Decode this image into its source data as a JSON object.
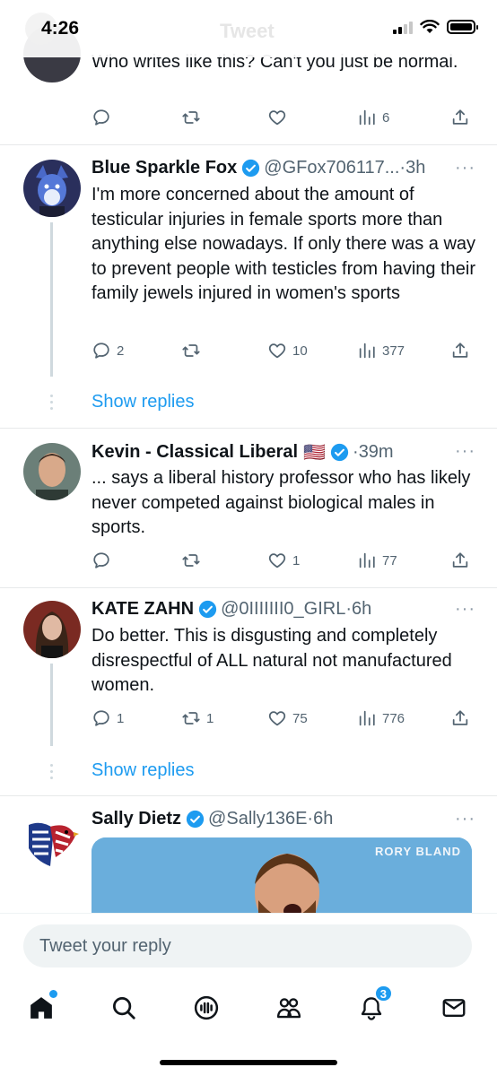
{
  "status_bar": {
    "time": "4:26",
    "header_title": "Tweet"
  },
  "partial_tweet": {
    "text": "Who writes like this? Can't you just be normal.",
    "views": "6"
  },
  "tweets": [
    {
      "name": "Blue Sparkle Fox",
      "handle": "@GFox706117...",
      "time": "3h",
      "text": "I'm more concerned about the amount of testicular injuries in female sports more than anything else nowadays. If only there was a way to prevent people with testicles from having their family jewels injured in women's sports",
      "replies": "2",
      "retweets": "",
      "likes": "10",
      "views": "377",
      "show_replies": "Show replies"
    },
    {
      "name": "Kevin - Classical Liberal",
      "flag": "🇺🇸",
      "handle": "",
      "time": "39m",
      "text": "... says a liberal history professor who has likely never competed against biological males in sports.",
      "replies": "",
      "retweets": "",
      "likes": "1",
      "views": "77"
    },
    {
      "name": "KATE ZAHN",
      "handle": "@0IIIIIII0_GIRL",
      "time": "6h",
      "text": "Do better. This is disgusting and completely disrespectful of ALL natural not manufactured women.",
      "replies": "1",
      "retweets": "1",
      "likes": "75",
      "views": "776",
      "show_replies": "Show replies"
    },
    {
      "name": "Sally Dietz",
      "handle": "@Sally136E",
      "time": "6h",
      "media_label": "RORY BLAND"
    }
  ],
  "reply": {
    "placeholder": "Tweet your reply"
  },
  "tabs": {
    "notifications_count": "3"
  },
  "colors": {
    "accent": "#1d9bf0",
    "verified": "#1d9bf0",
    "muted": "#536471"
  }
}
